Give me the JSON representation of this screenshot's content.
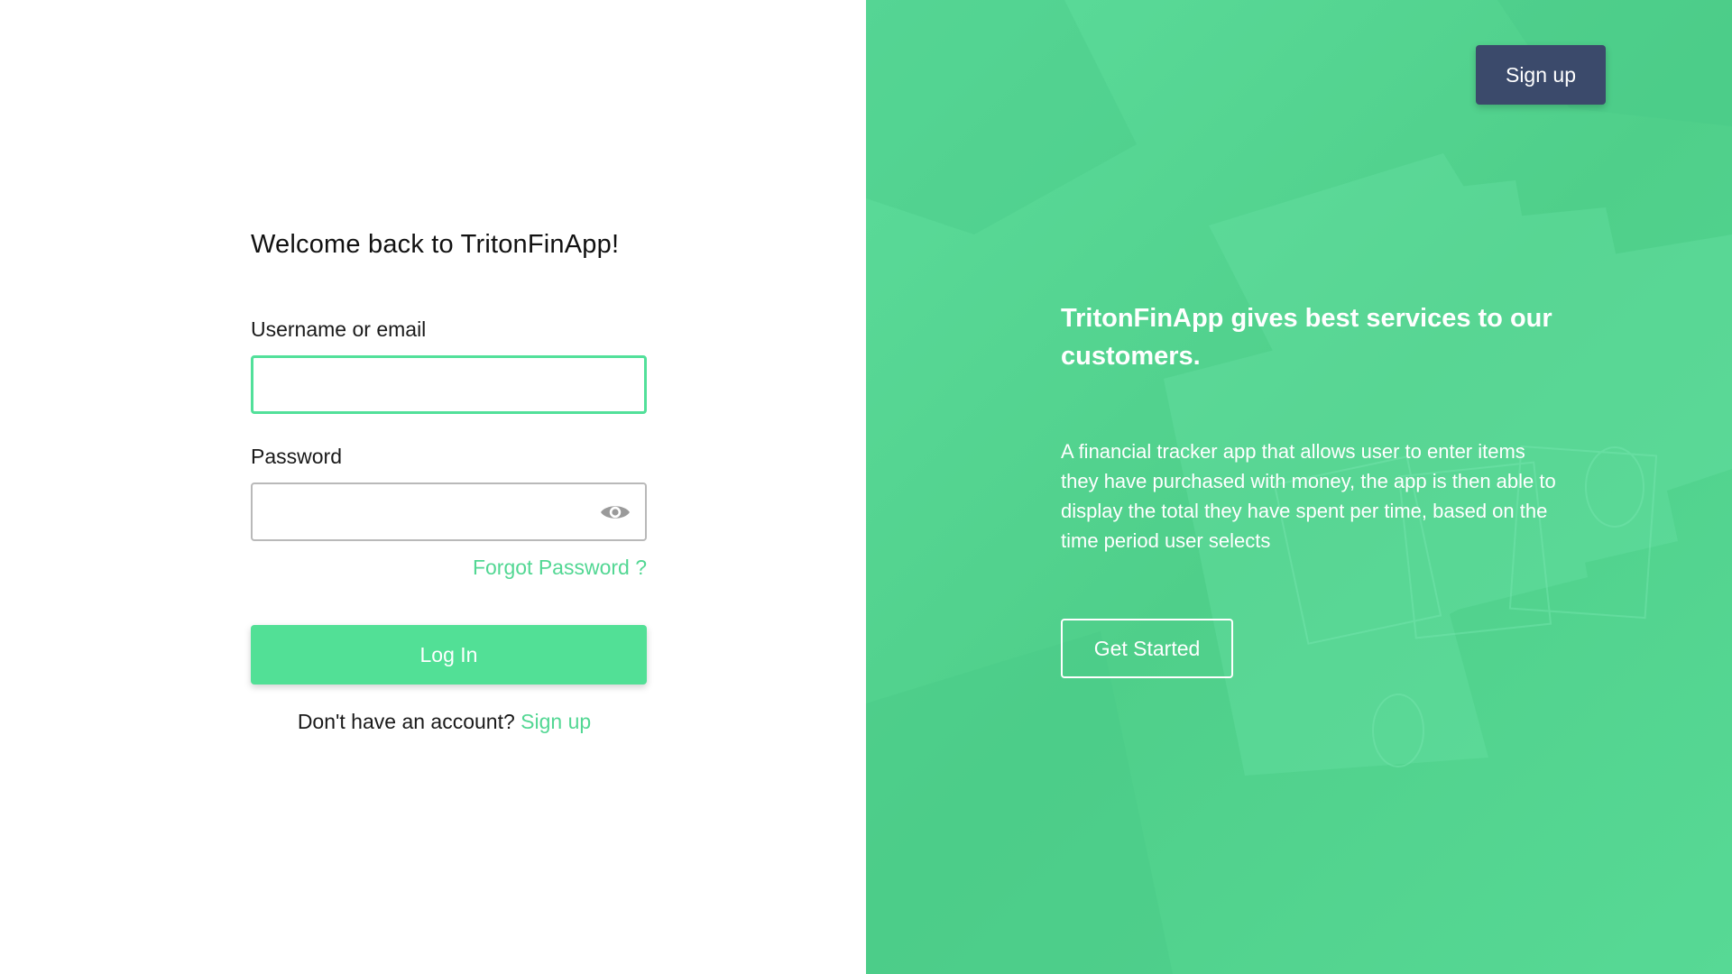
{
  "app_name": "TritonFinApp",
  "colors": {
    "accent": "#52e096",
    "accent_text": "#52d793",
    "navy": "#3b4a6b",
    "right_panel_green": "#55d592"
  },
  "login": {
    "title": "Welcome back to TritonFinApp!",
    "username_label": "Username or email",
    "username_value": "",
    "username_placeholder": "",
    "password_label": "Password",
    "password_value": "",
    "password_placeholder": "",
    "password_toggle_icon": "eye-icon",
    "forgot_password": "Forgot Password ?",
    "submit_label": "Log In",
    "no_account_text": "Don't have an account?",
    "signup_link": "Sign up"
  },
  "hero": {
    "signup_button": "Sign up",
    "headline": "TritonFinApp gives best services to our customers.",
    "description": "A financial tracker app that allows user to enter items they have purchased with money, the app is then able to display the total they have spent per time, based on the time period user selects",
    "cta_label": "Get Started",
    "background_image": "banknotes-photo"
  }
}
